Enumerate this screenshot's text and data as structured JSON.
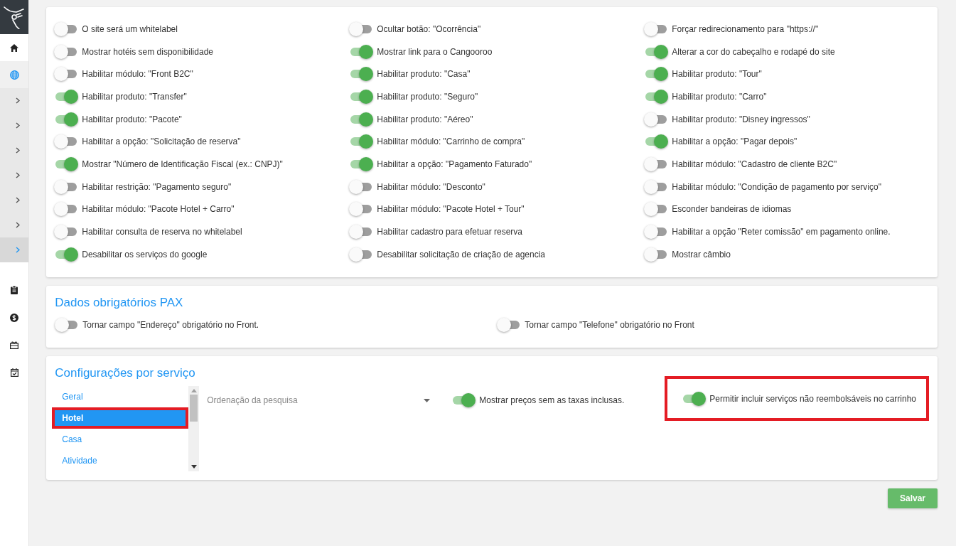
{
  "sidebar": {
    "nav": [
      {
        "kind": "home",
        "selected": false
      },
      {
        "kind": "globe",
        "selected": true
      }
    ],
    "submenu": [
      {
        "selected": false
      },
      {
        "selected": false
      },
      {
        "selected": false
      },
      {
        "selected": false
      },
      {
        "selected": false
      },
      {
        "selected": false
      },
      {
        "selected": true
      }
    ],
    "bottom_nav": [
      {
        "kind": "clipboard"
      },
      {
        "kind": "dollar"
      },
      {
        "kind": "gift"
      },
      {
        "kind": "calendar"
      }
    ]
  },
  "general_settings": {
    "columns": [
      [
        {
          "label": "O site será um whitelabel",
          "on": false
        },
        {
          "label": "Mostrar hotéis sem disponibilidade",
          "on": false
        },
        {
          "label": "Habilitar módulo: \"Front B2C\"",
          "on": false
        },
        {
          "label": "Habilitar produto: \"Transfer\"",
          "on": true
        },
        {
          "label": "Habilitar produto: \"Pacote\"",
          "on": true
        },
        {
          "label": "Habilitar a opção: \"Solicitação de reserva\"",
          "on": false
        },
        {
          "label": "Mostrar \"Número de Identificação Fiscal (ex.: CNPJ)\"",
          "on": true
        },
        {
          "label": "Habilitar restrição: \"Pagamento seguro\"",
          "on": false
        },
        {
          "label": "Habilitar módulo: \"Pacote Hotel + Carro\"",
          "on": false
        },
        {
          "label": "Habilitar consulta de reserva no whitelabel",
          "on": false
        },
        {
          "label": "Desabilitar os serviços do google",
          "on": true
        }
      ],
      [
        {
          "label": "Ocultar botão: \"Ocorrência\"",
          "on": false
        },
        {
          "label": "Mostrar link para o Cangooroo",
          "on": true
        },
        {
          "label": "Habilitar produto: \"Casa\"",
          "on": true
        },
        {
          "label": "Habilitar produto: \"Seguro\"",
          "on": true
        },
        {
          "label": "Habilitar produto: \"Aéreo\"",
          "on": true
        },
        {
          "label": "Habilitar módulo: \"Carrinho de compra\"",
          "on": true
        },
        {
          "label": "Habilitar a opção: \"Pagamento Faturado\"",
          "on": true
        },
        {
          "label": "Habilitar módulo: \"Desconto\"",
          "on": false
        },
        {
          "label": "Habilitar módulo: \"Pacote Hotel + Tour\"",
          "on": false
        },
        {
          "label": "Habilitar cadastro para efetuar reserva",
          "on": false
        },
        {
          "label": "Desabilitar solicitação de criação de agencia",
          "on": false
        }
      ],
      [
        {
          "label": "Forçar redirecionamento para \"https://\"",
          "on": false
        },
        {
          "label": "Alterar a cor do cabeçalho e rodapé do site",
          "on": true
        },
        {
          "label": "Habilitar produto: \"Tour\"",
          "on": true
        },
        {
          "label": "Habilitar produto: \"Carro\"",
          "on": true
        },
        {
          "label": "Habilitar produto: \"Disney ingressos\"",
          "on": false
        },
        {
          "label": "Habilitar a opção: \"Pagar depois\"",
          "on": true
        },
        {
          "label": "Habilitar módulo: \"Cadastro de cliente B2C\"",
          "on": false
        },
        {
          "label": "Habilitar módulo: \"Condição de pagamento por serviço\"",
          "on": false
        },
        {
          "label": "Esconder bandeiras de idiomas",
          "on": false
        },
        {
          "label": "Habilitar a opção \"Reter comissão\" em pagamento online.",
          "on": false
        },
        {
          "label": "Mostrar câmbio",
          "on": false
        }
      ]
    ]
  },
  "pax_section": {
    "title": "Dados obrigatórios PAX",
    "toggles": [
      {
        "label": "Tornar campo \"Endereço\" obrigatório no Front.",
        "on": false
      },
      {
        "label": "Tornar campo \"Telefone\" obrigatório no Front",
        "on": false
      }
    ]
  },
  "service_section": {
    "title": "Configurações por serviço",
    "services": [
      {
        "label": "Geral",
        "selected": false,
        "highlighted": false
      },
      {
        "label": "Hotel",
        "selected": true,
        "highlighted": true
      },
      {
        "label": "Casa",
        "selected": false,
        "highlighted": false
      },
      {
        "label": "Atividade",
        "selected": false,
        "highlighted": false
      }
    ],
    "sort_dropdown": {
      "placeholder": "Ordenação da pesquisa"
    },
    "toggles": [
      {
        "label": "Mostrar preços sem as taxas inclusas.",
        "on": true,
        "highlighted": false
      },
      {
        "label": "Permitir incluir serviços não reembolsáveis no carrinho",
        "on": true,
        "highlighted": true
      }
    ]
  },
  "save_button": {
    "label": "Salvar"
  }
}
